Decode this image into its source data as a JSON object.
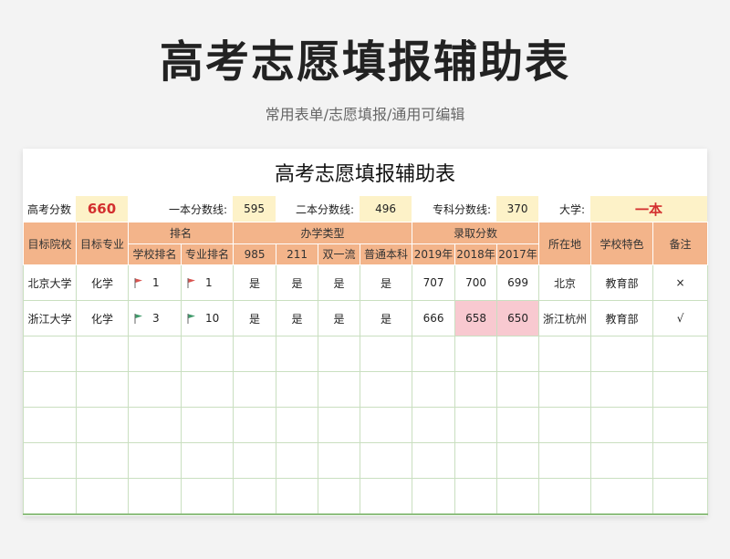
{
  "hero": {
    "title": "高考志愿填报辅助表",
    "subtitle": "常用表单/志愿填报/通用可编辑"
  },
  "sheet": {
    "title": "高考志愿填报辅助表",
    "info": {
      "score_label": "高考分数",
      "score_value": "660",
      "yiben_label": "一本分数线:",
      "yiben_value": "595",
      "erben_label": "二本分数线:",
      "erben_value": "496",
      "zhuanke_label": "专科分数线:",
      "zhuanke_value": "370",
      "daxue_label": "大学:",
      "daxue_value": "一本"
    },
    "headers": {
      "target_school": "目标院校",
      "target_major": "目标专业",
      "ranking": "排名",
      "school_rank": "学校排名",
      "major_rank": "专业排名",
      "school_type": "办学类型",
      "t985": "985",
      "t211": "211",
      "double_first": "双一流",
      "regular": "普通本科",
      "admission": "录取分数",
      "y2019": "2019年",
      "y2018": "2018年",
      "y2017": "2017年",
      "location": "所在地",
      "feature": "学校特色",
      "note": "备注"
    },
    "rows": [
      {
        "school": "北京大学",
        "major": "化学",
        "school_rank": "1",
        "major_rank": "1",
        "flag_color": "#d9534f",
        "t985": "是",
        "t211": "是",
        "double_first": "是",
        "regular": "是",
        "y2019": "707",
        "y2018": "700",
        "y2017": "699",
        "location": "北京",
        "feature": "教育部",
        "note": "×"
      },
      {
        "school": "浙江大学",
        "major": "化学",
        "school_rank": "3",
        "major_rank": "10",
        "flag_color": "#3f9a6a",
        "t985": "是",
        "t211": "是",
        "double_first": "是",
        "regular": "是",
        "y2019": "666",
        "y2018": "658",
        "y2017": "650",
        "location": "浙江杭州",
        "feature": "教育部",
        "note": "√"
      }
    ],
    "colors": {
      "header": "#f3b48a",
      "input": "#fdf2c8",
      "highlight": "#f8c9d0",
      "grid": "#c9dfc0"
    }
  }
}
